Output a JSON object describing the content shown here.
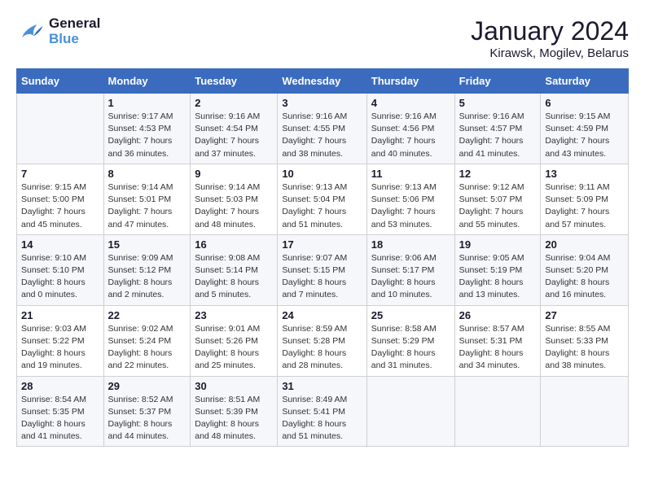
{
  "header": {
    "logo_general": "General",
    "logo_blue": "Blue",
    "month_title": "January 2024",
    "location": "Kirawsk, Mogilev, Belarus"
  },
  "calendar": {
    "weekdays": [
      "Sunday",
      "Monday",
      "Tuesday",
      "Wednesday",
      "Thursday",
      "Friday",
      "Saturday"
    ],
    "weeks": [
      [
        {
          "day": "",
          "sunrise": "",
          "sunset": "",
          "daylight": ""
        },
        {
          "day": "1",
          "sunrise": "Sunrise: 9:17 AM",
          "sunset": "Sunset: 4:53 PM",
          "daylight": "Daylight: 7 hours and 36 minutes."
        },
        {
          "day": "2",
          "sunrise": "Sunrise: 9:16 AM",
          "sunset": "Sunset: 4:54 PM",
          "daylight": "Daylight: 7 hours and 37 minutes."
        },
        {
          "day": "3",
          "sunrise": "Sunrise: 9:16 AM",
          "sunset": "Sunset: 4:55 PM",
          "daylight": "Daylight: 7 hours and 38 minutes."
        },
        {
          "day": "4",
          "sunrise": "Sunrise: 9:16 AM",
          "sunset": "Sunset: 4:56 PM",
          "daylight": "Daylight: 7 hours and 40 minutes."
        },
        {
          "day": "5",
          "sunrise": "Sunrise: 9:16 AM",
          "sunset": "Sunset: 4:57 PM",
          "daylight": "Daylight: 7 hours and 41 minutes."
        },
        {
          "day": "6",
          "sunrise": "Sunrise: 9:15 AM",
          "sunset": "Sunset: 4:59 PM",
          "daylight": "Daylight: 7 hours and 43 minutes."
        }
      ],
      [
        {
          "day": "7",
          "sunrise": "Sunrise: 9:15 AM",
          "sunset": "Sunset: 5:00 PM",
          "daylight": "Daylight: 7 hours and 45 minutes."
        },
        {
          "day": "8",
          "sunrise": "Sunrise: 9:14 AM",
          "sunset": "Sunset: 5:01 PM",
          "daylight": "Daylight: 7 hours and 47 minutes."
        },
        {
          "day": "9",
          "sunrise": "Sunrise: 9:14 AM",
          "sunset": "Sunset: 5:03 PM",
          "daylight": "Daylight: 7 hours and 48 minutes."
        },
        {
          "day": "10",
          "sunrise": "Sunrise: 9:13 AM",
          "sunset": "Sunset: 5:04 PM",
          "daylight": "Daylight: 7 hours and 51 minutes."
        },
        {
          "day": "11",
          "sunrise": "Sunrise: 9:13 AM",
          "sunset": "Sunset: 5:06 PM",
          "daylight": "Daylight: 7 hours and 53 minutes."
        },
        {
          "day": "12",
          "sunrise": "Sunrise: 9:12 AM",
          "sunset": "Sunset: 5:07 PM",
          "daylight": "Daylight: 7 hours and 55 minutes."
        },
        {
          "day": "13",
          "sunrise": "Sunrise: 9:11 AM",
          "sunset": "Sunset: 5:09 PM",
          "daylight": "Daylight: 7 hours and 57 minutes."
        }
      ],
      [
        {
          "day": "14",
          "sunrise": "Sunrise: 9:10 AM",
          "sunset": "Sunset: 5:10 PM",
          "daylight": "Daylight: 8 hours and 0 minutes."
        },
        {
          "day": "15",
          "sunrise": "Sunrise: 9:09 AM",
          "sunset": "Sunset: 5:12 PM",
          "daylight": "Daylight: 8 hours and 2 minutes."
        },
        {
          "day": "16",
          "sunrise": "Sunrise: 9:08 AM",
          "sunset": "Sunset: 5:14 PM",
          "daylight": "Daylight: 8 hours and 5 minutes."
        },
        {
          "day": "17",
          "sunrise": "Sunrise: 9:07 AM",
          "sunset": "Sunset: 5:15 PM",
          "daylight": "Daylight: 8 hours and 7 minutes."
        },
        {
          "day": "18",
          "sunrise": "Sunrise: 9:06 AM",
          "sunset": "Sunset: 5:17 PM",
          "daylight": "Daylight: 8 hours and 10 minutes."
        },
        {
          "day": "19",
          "sunrise": "Sunrise: 9:05 AM",
          "sunset": "Sunset: 5:19 PM",
          "daylight": "Daylight: 8 hours and 13 minutes."
        },
        {
          "day": "20",
          "sunrise": "Sunrise: 9:04 AM",
          "sunset": "Sunset: 5:20 PM",
          "daylight": "Daylight: 8 hours and 16 minutes."
        }
      ],
      [
        {
          "day": "21",
          "sunrise": "Sunrise: 9:03 AM",
          "sunset": "Sunset: 5:22 PM",
          "daylight": "Daylight: 8 hours and 19 minutes."
        },
        {
          "day": "22",
          "sunrise": "Sunrise: 9:02 AM",
          "sunset": "Sunset: 5:24 PM",
          "daylight": "Daylight: 8 hours and 22 minutes."
        },
        {
          "day": "23",
          "sunrise": "Sunrise: 9:01 AM",
          "sunset": "Sunset: 5:26 PM",
          "daylight": "Daylight: 8 hours and 25 minutes."
        },
        {
          "day": "24",
          "sunrise": "Sunrise: 8:59 AM",
          "sunset": "Sunset: 5:28 PM",
          "daylight": "Daylight: 8 hours and 28 minutes."
        },
        {
          "day": "25",
          "sunrise": "Sunrise: 8:58 AM",
          "sunset": "Sunset: 5:29 PM",
          "daylight": "Daylight: 8 hours and 31 minutes."
        },
        {
          "day": "26",
          "sunrise": "Sunrise: 8:57 AM",
          "sunset": "Sunset: 5:31 PM",
          "daylight": "Daylight: 8 hours and 34 minutes."
        },
        {
          "day": "27",
          "sunrise": "Sunrise: 8:55 AM",
          "sunset": "Sunset: 5:33 PM",
          "daylight": "Daylight: 8 hours and 38 minutes."
        }
      ],
      [
        {
          "day": "28",
          "sunrise": "Sunrise: 8:54 AM",
          "sunset": "Sunset: 5:35 PM",
          "daylight": "Daylight: 8 hours and 41 minutes."
        },
        {
          "day": "29",
          "sunrise": "Sunrise: 8:52 AM",
          "sunset": "Sunset: 5:37 PM",
          "daylight": "Daylight: 8 hours and 44 minutes."
        },
        {
          "day": "30",
          "sunrise": "Sunrise: 8:51 AM",
          "sunset": "Sunset: 5:39 PM",
          "daylight": "Daylight: 8 hours and 48 minutes."
        },
        {
          "day": "31",
          "sunrise": "Sunrise: 8:49 AM",
          "sunset": "Sunset: 5:41 PM",
          "daylight": "Daylight: 8 hours and 51 minutes."
        },
        {
          "day": "",
          "sunrise": "",
          "sunset": "",
          "daylight": ""
        },
        {
          "day": "",
          "sunrise": "",
          "sunset": "",
          "daylight": ""
        },
        {
          "day": "",
          "sunrise": "",
          "sunset": "",
          "daylight": ""
        }
      ]
    ]
  }
}
